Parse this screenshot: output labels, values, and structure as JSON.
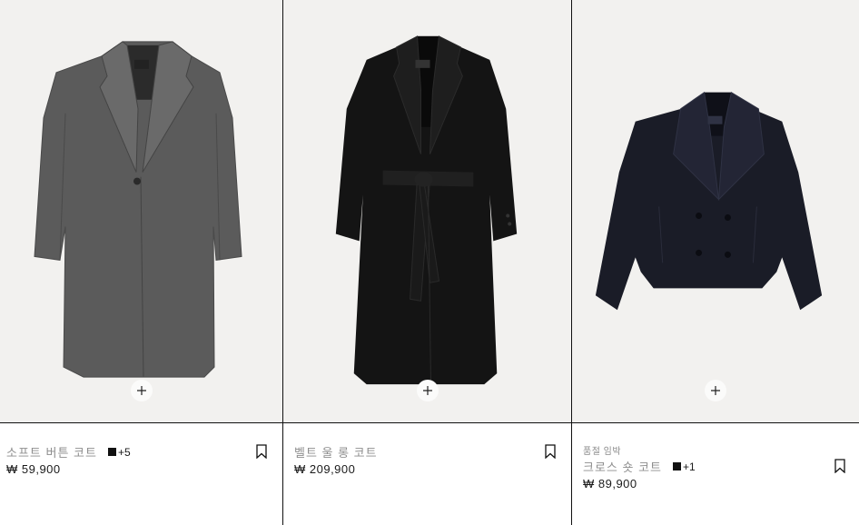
{
  "products": [
    {
      "name": "소프트 버튼 코트",
      "color_swatch": "#111111",
      "more_colors": "+5",
      "price": "₩ 59,900",
      "badge": "",
      "image": "gray-single-breasted-long-coat",
      "coat_color": "#5a5a5a"
    },
    {
      "name": "벨트 울 롱 코트",
      "color_swatch": "",
      "more_colors": "",
      "price": "₩ 209,900",
      "badge": "",
      "image": "black-belted-long-coat",
      "coat_color": "#141414"
    },
    {
      "name": "크로스 숏 코트",
      "color_swatch": "#111111",
      "more_colors": "+1",
      "price": "₩ 89,900",
      "badge": "품절 임박",
      "image": "navy-double-breasted-short-coat",
      "coat_color": "#1a1c27"
    }
  ],
  "icons": {
    "quick_add": "plus-icon",
    "save": "bookmark-icon"
  },
  "colors": {
    "image_background": "#f2f1ef",
    "text_muted": "#8e8e8e",
    "text_primary": "#1a1a1a"
  }
}
